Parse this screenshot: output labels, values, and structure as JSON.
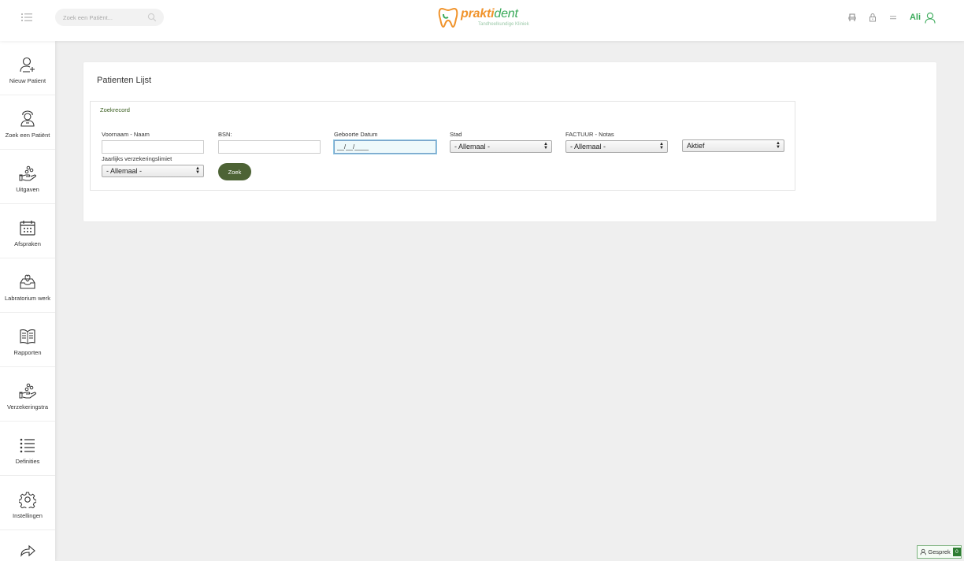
{
  "header": {
    "search_placeholder": "Zoek een Patiënt...",
    "logo": {
      "part1": "prakti",
      "part2": "dent",
      "subtitle": "Tandheelkundige Kliniek"
    },
    "user_name": "Ali",
    "colors": {
      "brand_green": "#3aaa5a",
      "brand_orange": "#f0932b",
      "dark_green": "#4d6335"
    }
  },
  "sidebar": {
    "items": [
      {
        "label": "Nieuw Patient",
        "icon": "add-user-icon"
      },
      {
        "label": "Zoek een Patiënt",
        "icon": "patient-search-icon"
      },
      {
        "label": "Uitgaven",
        "icon": "hand-coins-icon"
      },
      {
        "label": "Afspraken",
        "icon": "calendar-icon"
      },
      {
        "label": "Labratorium werk",
        "icon": "lab-tray-icon"
      },
      {
        "label": "Rapporten",
        "icon": "book-icon"
      },
      {
        "label": "Verzekeringstra",
        "icon": "hand-coins-icon"
      },
      {
        "label": "Definities",
        "icon": "list-icon"
      },
      {
        "label": "Instellingen",
        "icon": "gear-icon"
      }
    ]
  },
  "main": {
    "title": "Patienten Lijst",
    "legend": "Zoekrecord",
    "fields": {
      "name_label": "Voornaam - Naam",
      "name_value": "",
      "bsn_label": "BSN:",
      "bsn_value": "",
      "dob_label": "Geboorte Datum",
      "dob_value": "__/__/____",
      "stad_label": "Stad",
      "stad_value": "- Allemaal -",
      "factuur_label": "FACTUUR - Notas",
      "factuur_value": "- Allemaal -",
      "status_value": "Aktief",
      "limit_label": "Jaarlijks verzekeringslimiet",
      "limit_value": "- Allemaal -"
    },
    "search_button": "Zoek"
  },
  "chat": {
    "label": "Gesprek",
    "count": "0"
  }
}
